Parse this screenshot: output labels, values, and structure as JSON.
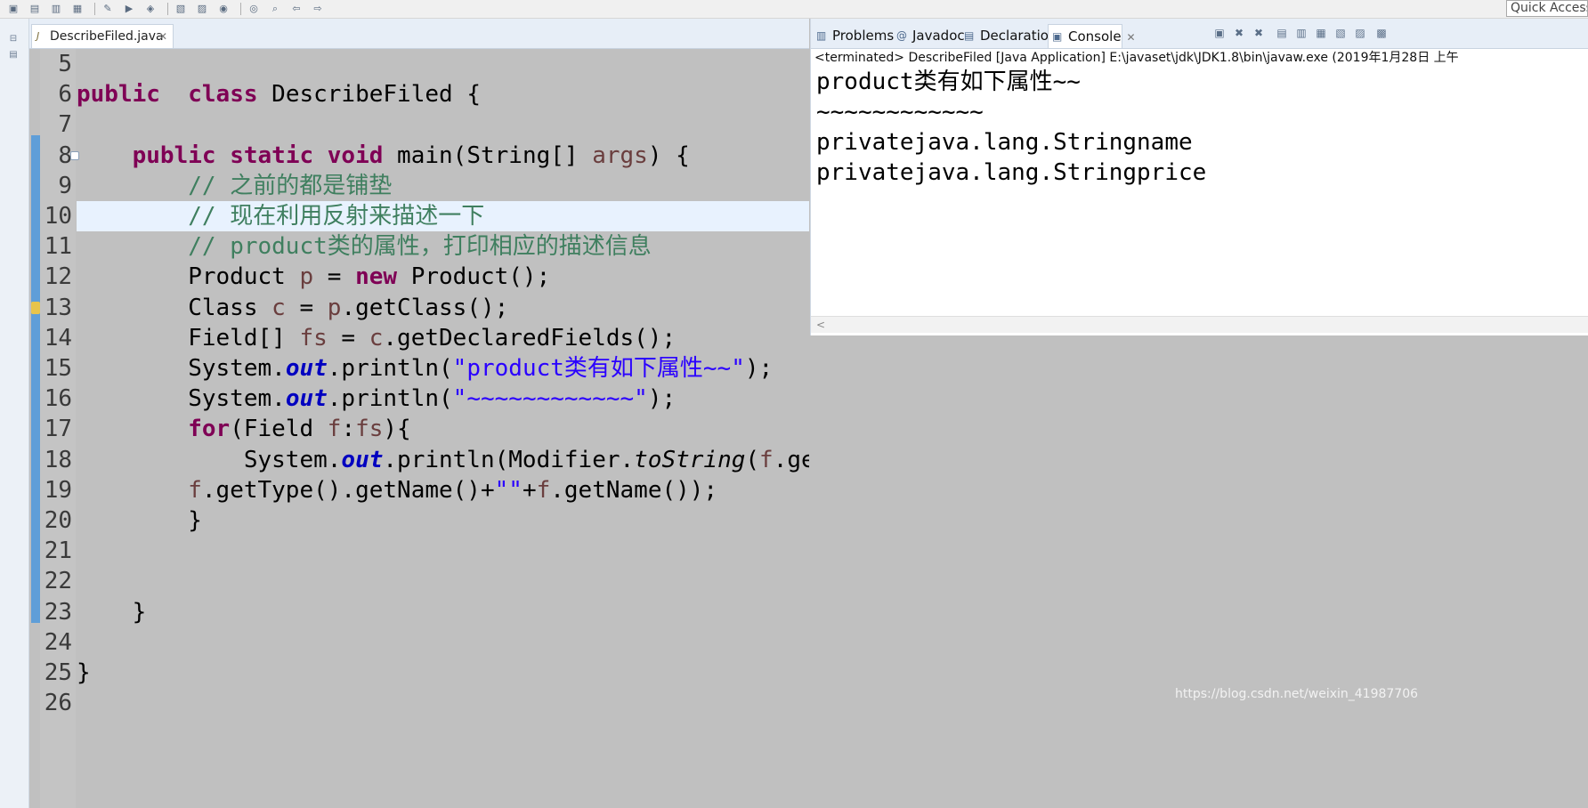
{
  "toolbar": {
    "quick_access_text": "Quick Access",
    "icons": [
      "new-icon",
      "save-icon",
      "save-all-icon",
      "print-icon",
      "debug-icon",
      "run-icon",
      "external-tools-icon",
      "new-java-project-icon",
      "new-package-icon",
      "new-class-icon",
      "open-type-icon",
      "search-icon",
      "back-icon",
      "forward-icon"
    ]
  },
  "editor": {
    "tab_label": "DescribeFiled.java",
    "lines": [
      {
        "n": "5",
        "parts": []
      },
      {
        "n": "6",
        "parts": [
          [
            "kw",
            "public"
          ],
          [
            "",
            "  "
          ],
          [
            "kw",
            "class"
          ],
          [
            "",
            " DescribeFiled {"
          ]
        ]
      },
      {
        "n": "7",
        "parts": []
      },
      {
        "n": "8",
        "parts": [
          [
            "",
            "    "
          ],
          [
            "kw",
            "public"
          ],
          [
            "",
            " "
          ],
          [
            "kw",
            "static"
          ],
          [
            "",
            " "
          ],
          [
            "kw",
            "void"
          ],
          [
            "",
            " main(String[] "
          ],
          [
            "vr",
            "args"
          ],
          [
            "",
            ") {"
          ]
        ]
      },
      {
        "n": "9",
        "parts": [
          [
            "",
            "        "
          ],
          [
            "cm",
            "// 之前的都是铺垫"
          ]
        ]
      },
      {
        "n": "10",
        "parts": [
          [
            "",
            "        "
          ],
          [
            "cm",
            "// 现在利用反射来描述一下"
          ]
        ]
      },
      {
        "n": "11",
        "parts": [
          [
            "",
            "        "
          ],
          [
            "cm",
            "// product类的属性，打印相应的描述信息"
          ]
        ]
      },
      {
        "n": "12",
        "parts": [
          [
            "",
            "        Product "
          ],
          [
            "vr",
            "p"
          ],
          [
            "",
            " = "
          ],
          [
            "kw",
            "new"
          ],
          [
            "",
            " Product();"
          ]
        ]
      },
      {
        "n": "13",
        "parts": [
          [
            "",
            "        Class "
          ],
          [
            "vr",
            "c"
          ],
          [
            "",
            " = "
          ],
          [
            "vr",
            "p"
          ],
          [
            "",
            ".getClass();"
          ]
        ]
      },
      {
        "n": "14",
        "parts": [
          [
            "",
            "        Field[] "
          ],
          [
            "vr",
            "fs"
          ],
          [
            "",
            " = "
          ],
          [
            "vr",
            "c"
          ],
          [
            "",
            ".getDeclaredFields();"
          ]
        ]
      },
      {
        "n": "15",
        "parts": [
          [
            "",
            "        System."
          ],
          [
            "fd",
            "out"
          ],
          [
            "",
            ".println("
          ],
          [
            "st",
            "\"product类有如下属性~~\""
          ],
          [
            "",
            ");"
          ]
        ]
      },
      {
        "n": "16",
        "parts": [
          [
            "",
            "        System."
          ],
          [
            "fd",
            "out"
          ],
          [
            "",
            ".println("
          ],
          [
            "st",
            "\"~~~~~~~~~~~~\""
          ],
          [
            "",
            ");"
          ]
        ]
      },
      {
        "n": "17",
        "parts": [
          [
            "",
            "        "
          ],
          [
            "kw",
            "for"
          ],
          [
            "",
            "(Field "
          ],
          [
            "vr",
            "f"
          ],
          [
            "",
            ":"
          ],
          [
            "vr",
            "fs"
          ],
          [
            "",
            "){"
          ]
        ]
      },
      {
        "n": "18",
        "parts": [
          [
            "",
            "            System."
          ],
          [
            "fd",
            "out"
          ],
          [
            "",
            ".println(Modifier."
          ],
          [
            "it",
            "toString"
          ],
          [
            "",
            "("
          ],
          [
            "vr",
            "f"
          ],
          [
            "",
            ".getModifiers())+"
          ],
          [
            "st",
            "\"\""
          ],
          [
            "",
            "+"
          ]
        ]
      },
      {
        "n": "19",
        "parts": [
          [
            "",
            "        "
          ],
          [
            "vr",
            "f"
          ],
          [
            "",
            ".getType().getName()+"
          ],
          [
            "st",
            "\"\""
          ],
          [
            "",
            "+"
          ],
          [
            "vr",
            "f"
          ],
          [
            "",
            ".getName());"
          ]
        ]
      },
      {
        "n": "20",
        "parts": [
          [
            "",
            "        }"
          ]
        ]
      },
      {
        "n": "21",
        "parts": []
      },
      {
        "n": "22",
        "parts": []
      },
      {
        "n": "23",
        "parts": [
          [
            "",
            "    }"
          ]
        ]
      },
      {
        "n": "24",
        "parts": []
      },
      {
        "n": "25",
        "parts": [
          [
            "",
            "}"
          ]
        ]
      },
      {
        "n": "26",
        "parts": []
      }
    ]
  },
  "console": {
    "tabs": [
      {
        "label": "Problems",
        "icon": "problems-icon",
        "active": false
      },
      {
        "label": "Javadoc",
        "icon": "javadoc-icon",
        "active": false
      },
      {
        "label": "Declaration",
        "icon": "declaration-icon",
        "active": false
      },
      {
        "label": "Console",
        "icon": "console-icon",
        "active": true
      }
    ],
    "status": "<terminated> DescribeFiled [Java Application] E:\\javaset\\jdk\\JDK1.8\\bin\\javaw.exe (2019年1月28日 上午",
    "output": [
      "product类有如下属性~~",
      "~~~~~~~~~~~~",
      "privatejava.lang.Stringname",
      "privatejava.lang.Stringprice"
    ]
  },
  "watermark": "https://blog.csdn.net/weixin_41987706",
  "colors": {
    "keyword": "#7f0055",
    "comment": "#3f7f5f",
    "string": "#2a00ff",
    "field": "#0000c0",
    "local_var": "#6a3e3e",
    "current_line": "#e8f2fe"
  }
}
